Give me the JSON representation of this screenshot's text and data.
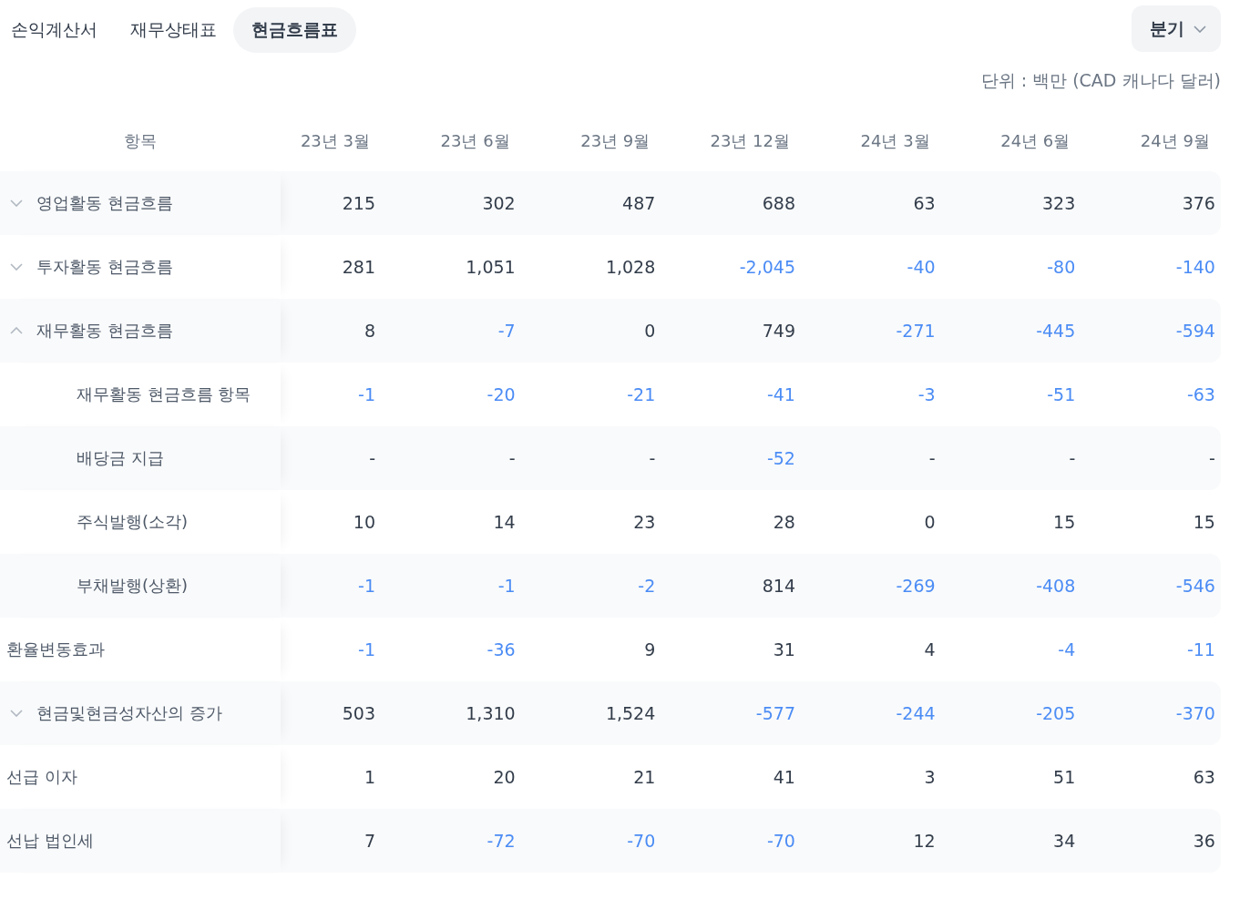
{
  "tabs": [
    {
      "label": "손익계산서",
      "selected": false
    },
    {
      "label": "재무상태표",
      "selected": false
    },
    {
      "label": "현금흐름표",
      "selected": true
    }
  ],
  "period_dropdown": {
    "value": "분기"
  },
  "unit_note": "단위 : 백만 (CAD 캐나다 달러)",
  "table": {
    "label_header": "항목",
    "columns": [
      "23년 3월",
      "23년 6월",
      "23년 9월",
      "23년 12월",
      "24년 3월",
      "24년 6월",
      "24년 9월"
    ],
    "rows": [
      {
        "kind": "group",
        "label": "영업활동 현금흐름",
        "expanded": false,
        "cells": [
          {
            "text": "215",
            "negative": false
          },
          {
            "text": "302",
            "negative": false
          },
          {
            "text": "487",
            "negative": false
          },
          {
            "text": "688",
            "negative": false
          },
          {
            "text": "63",
            "negative": false
          },
          {
            "text": "323",
            "negative": false
          },
          {
            "text": "376",
            "negative": false
          }
        ]
      },
      {
        "kind": "group",
        "label": "투자활동 현금흐름",
        "expanded": false,
        "cells": [
          {
            "text": "281",
            "negative": false
          },
          {
            "text": "1,051",
            "negative": false
          },
          {
            "text": "1,028",
            "negative": false
          },
          {
            "text": "-2,045",
            "negative": true
          },
          {
            "text": "-40",
            "negative": true
          },
          {
            "text": "-80",
            "negative": true
          },
          {
            "text": "-140",
            "negative": true
          }
        ]
      },
      {
        "kind": "group",
        "label": "재무활동 현금흐름",
        "expanded": true,
        "cells": [
          {
            "text": "8",
            "negative": false
          },
          {
            "text": "-7",
            "negative": true
          },
          {
            "text": "0",
            "negative": false
          },
          {
            "text": "749",
            "negative": false
          },
          {
            "text": "-271",
            "negative": true
          },
          {
            "text": "-445",
            "negative": true
          },
          {
            "text": "-594",
            "negative": true
          }
        ],
        "children": [
          {
            "label": "재무활동 현금흐름 항목",
            "cells": [
              {
                "text": "-1",
                "negative": true
              },
              {
                "text": "-20",
                "negative": true
              },
              {
                "text": "-21",
                "negative": true
              },
              {
                "text": "-41",
                "negative": true
              },
              {
                "text": "-3",
                "negative": true
              },
              {
                "text": "-51",
                "negative": true
              },
              {
                "text": "-63",
                "negative": true
              }
            ]
          },
          {
            "label": "배당금 지급",
            "cells": [
              {
                "text": "-",
                "negative": false
              },
              {
                "text": "-",
                "negative": false
              },
              {
                "text": "-",
                "negative": false
              },
              {
                "text": "-52",
                "negative": true
              },
              {
                "text": "-",
                "negative": false
              },
              {
                "text": "-",
                "negative": false
              },
              {
                "text": "-",
                "negative": false
              }
            ]
          },
          {
            "label": "주식발행(소각)",
            "cells": [
              {
                "text": "10",
                "negative": false
              },
              {
                "text": "14",
                "negative": false
              },
              {
                "text": "23",
                "negative": false
              },
              {
                "text": "28",
                "negative": false
              },
              {
                "text": "0",
                "negative": false
              },
              {
                "text": "15",
                "negative": false
              },
              {
                "text": "15",
                "negative": false
              }
            ]
          },
          {
            "label": "부채발행(상환)",
            "cells": [
              {
                "text": "-1",
                "negative": true
              },
              {
                "text": "-1",
                "negative": true
              },
              {
                "text": "-2",
                "negative": true
              },
              {
                "text": "814",
                "negative": false
              },
              {
                "text": "-269",
                "negative": true
              },
              {
                "text": "-408",
                "negative": true
              },
              {
                "text": "-546",
                "negative": true
              }
            ]
          }
        ]
      },
      {
        "kind": "plain",
        "label": "환율변동효과",
        "cells": [
          {
            "text": "-1",
            "negative": true
          },
          {
            "text": "-36",
            "negative": true
          },
          {
            "text": "9",
            "negative": false
          },
          {
            "text": "31",
            "negative": false
          },
          {
            "text": "4",
            "negative": false
          },
          {
            "text": "-4",
            "negative": true
          },
          {
            "text": "-11",
            "negative": true
          }
        ]
      },
      {
        "kind": "group",
        "label": "현금및현금성자산의 증가",
        "expanded": false,
        "cells": [
          {
            "text": "503",
            "negative": false
          },
          {
            "text": "1,310",
            "negative": false
          },
          {
            "text": "1,524",
            "negative": false
          },
          {
            "text": "-577",
            "negative": true
          },
          {
            "text": "-244",
            "negative": true
          },
          {
            "text": "-205",
            "negative": true
          },
          {
            "text": "-370",
            "negative": true
          }
        ]
      },
      {
        "kind": "plain",
        "label": "선급 이자",
        "cells": [
          {
            "text": "1",
            "negative": false
          },
          {
            "text": "20",
            "negative": false
          },
          {
            "text": "21",
            "negative": false
          },
          {
            "text": "41",
            "negative": false
          },
          {
            "text": "3",
            "negative": false
          },
          {
            "text": "51",
            "negative": false
          },
          {
            "text": "63",
            "negative": false
          }
        ]
      },
      {
        "kind": "plain",
        "label": "선납 법인세",
        "cells": [
          {
            "text": "7",
            "negative": false
          },
          {
            "text": "-72",
            "negative": true
          },
          {
            "text": "-70",
            "negative": true
          },
          {
            "text": "-70",
            "negative": true
          },
          {
            "text": "12",
            "negative": false
          },
          {
            "text": "34",
            "negative": false
          },
          {
            "text": "36",
            "negative": false
          }
        ]
      }
    ]
  }
}
